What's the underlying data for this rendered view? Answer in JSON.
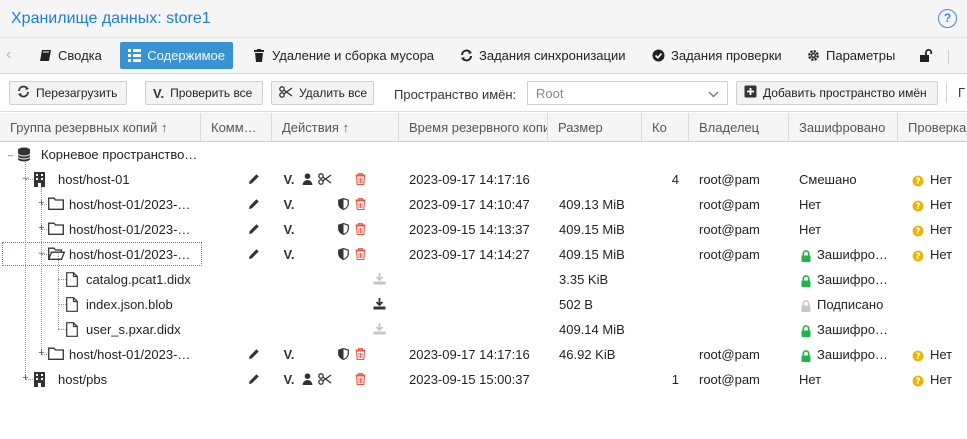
{
  "window": {
    "title": "Хранилище данных: store1",
    "help_icon": "help-icon"
  },
  "tabs": [
    {
      "label": "Сводка",
      "icon": "book-icon",
      "active": false
    },
    {
      "label": "Содержимое",
      "icon": "grid-icon",
      "active": true
    },
    {
      "label": "Удаление и сборка мусора",
      "icon": "trash-icon",
      "active": false
    },
    {
      "label": "Задания синхронизации",
      "icon": "sync-icon",
      "active": false
    },
    {
      "label": "Задания проверки",
      "icon": "check-circle-icon",
      "active": false
    },
    {
      "label": "Параметры",
      "icon": "gear-icon",
      "active": false
    }
  ],
  "toolbar": {
    "reload": "Перезагрузить",
    "verify_all": "Проверить все",
    "prune_all": "Удалить все",
    "namespace_label": "Пространство имён:",
    "namespace_value": "Root",
    "add_namespace": "Добавить пространство имён"
  },
  "columns": {
    "group": "Группа резервных копий ↑",
    "comment": "Комм…",
    "actions": "Действия ↑",
    "time": "Время резервного копи",
    "size": "Размер",
    "count": "Ко",
    "owner": "Владелец",
    "encrypted": "Зашифровано",
    "verify": "Проверка"
  },
  "rows": [
    {
      "name": "Корневое пространство…",
      "time": "",
      "size": "",
      "count": "",
      "owner": "",
      "encrypted": "",
      "verify": ""
    },
    {
      "name": "host/host-01",
      "time": "2023-09-17 14:17:16",
      "size": "",
      "count": "4",
      "owner": "root@pam",
      "encrypted": "Смешано",
      "verify": "Нет"
    },
    {
      "name": "host/host-01/2023-…",
      "time": "2023-09-17 14:10:47",
      "size": "409.13 MiB",
      "count": "",
      "owner": "root@pam",
      "encrypted": "Нет",
      "verify": "Нет"
    },
    {
      "name": "host/host-01/2023-…",
      "time": "2023-09-15 14:13:37",
      "size": "409.15 MiB",
      "count": "",
      "owner": "root@pam",
      "encrypted": "Нет",
      "verify": "Нет"
    },
    {
      "name": "host/host-01/2023-…",
      "time": "2023-09-17 14:14:27",
      "size": "409.15 MiB",
      "count": "",
      "owner": "root@pam",
      "encrypted": "Зашифро…",
      "verify": "Нет"
    },
    {
      "name": "catalog.pcat1.didx",
      "time": "",
      "size": "3.35 KiB",
      "count": "",
      "owner": "",
      "encrypted": "Зашифро…",
      "verify": ""
    },
    {
      "name": "index.json.blob",
      "time": "",
      "size": "502 B",
      "count": "",
      "owner": "",
      "encrypted": "Подписано",
      "verify": ""
    },
    {
      "name": "user_s.pxar.didx",
      "time": "",
      "size": "409.14 MiB",
      "count": "",
      "owner": "",
      "encrypted": "Зашифро…",
      "verify": ""
    },
    {
      "name": "host/host-01/2023-…",
      "time": "2023-09-17 14:17:16",
      "size": "46.92 KiB",
      "count": "",
      "owner": "root@pam",
      "encrypted": "Зашифро…",
      "verify": "Нет"
    },
    {
      "name": "host/pbs",
      "time": "2023-09-15 15:00:37",
      "size": "",
      "count": "1",
      "owner": "root@pam",
      "encrypted": "Нет",
      "verify": "Нет"
    }
  ],
  "colors": {
    "accent": "#3892d4",
    "title": "#1a7dd8",
    "danger": "#e2574c",
    "lock_green": "#21b24b",
    "question_yellow": "#f0b400"
  }
}
